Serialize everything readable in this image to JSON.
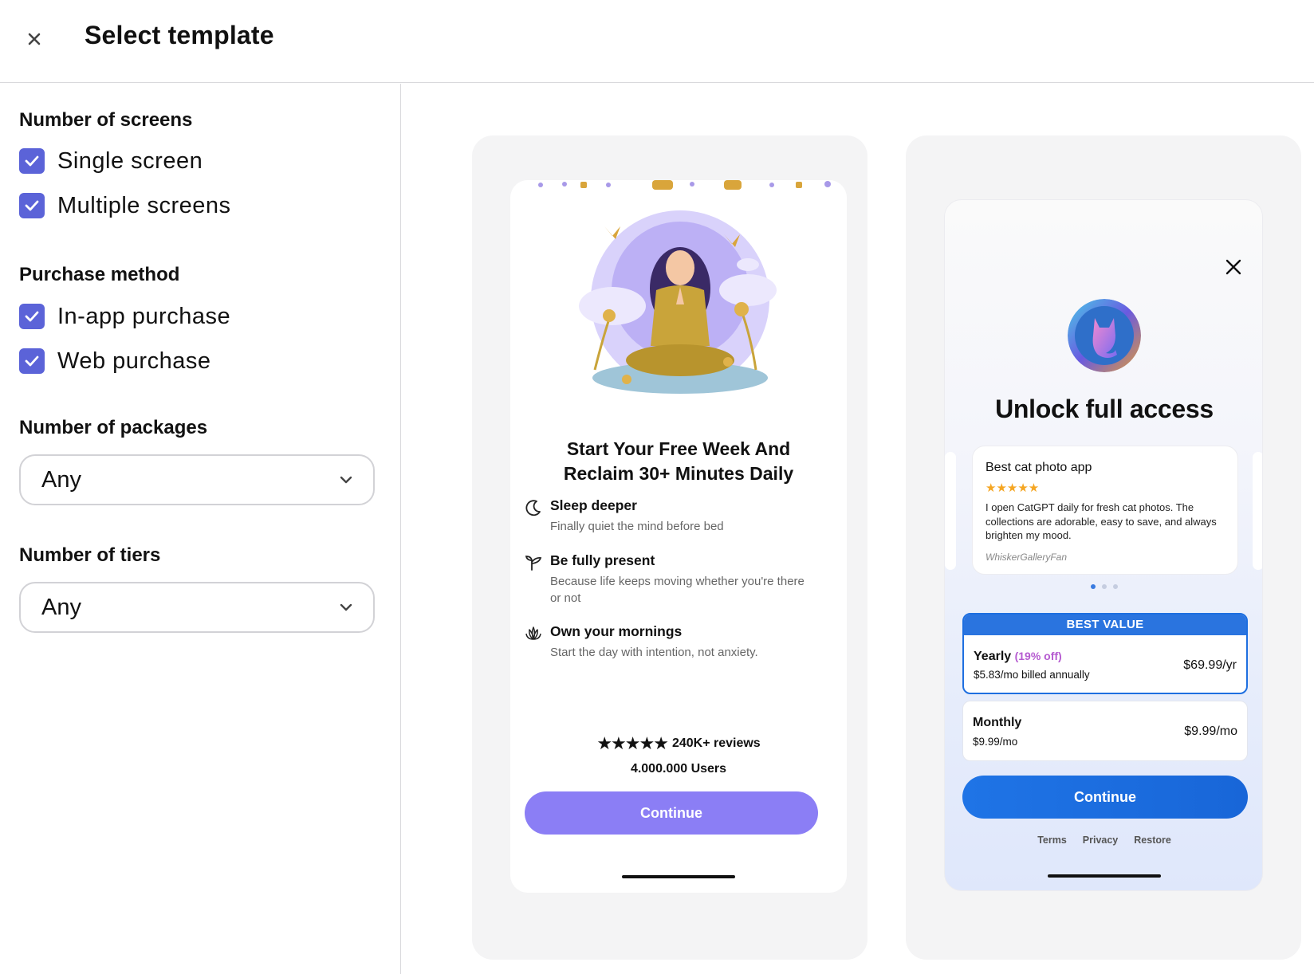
{
  "header": {
    "title": "Select template"
  },
  "sidebar": {
    "screens": {
      "title": "Number of screens",
      "options": [
        "Single screen",
        "Multiple screens"
      ],
      "checked": [
        true,
        true
      ]
    },
    "purchase": {
      "title": "Purchase method",
      "options": [
        "In-app purchase",
        "Web purchase"
      ],
      "checked": [
        true,
        true
      ]
    },
    "packages": {
      "title": "Number of packages",
      "value": "Any"
    },
    "tiers": {
      "title": "Number of tiers",
      "value": "Any"
    }
  },
  "templates": [
    {
      "headline_line1": "Start Your Free Week And",
      "headline_line2": "Reclaim 30+ Minutes Daily",
      "features": [
        {
          "icon": "moon-icon",
          "title": "Sleep deeper",
          "desc": "Finally quiet the mind before bed"
        },
        {
          "icon": "sprout-icon",
          "title": "Be fully present",
          "desc": "Because life keeps moving whether you're there or not"
        },
        {
          "icon": "lotus-icon",
          "title": "Own your mornings",
          "desc": "Start the day with intention, not anxiety."
        }
      ],
      "stars": "★★★★★",
      "reviews": "240K+ reviews",
      "users": "4.000.000 Users",
      "cta": "Continue",
      "accent": "#8b7ef5"
    },
    {
      "headline": "Unlock full access",
      "review": {
        "title": "Best cat photo app",
        "stars": "★★★★★",
        "body": "I open CatGPT daily for fresh cat photos. The collections are adorable, easy to save, and always brighten my mood.",
        "author": "WhiskerGalleryFan"
      },
      "badge": "BEST VALUE",
      "packages": [
        {
          "name": "Yearly",
          "discount": "(19% off)",
          "sub": "$5.83/mo billed annually",
          "price": "$69.99/yr"
        },
        {
          "name": "Monthly",
          "sub": "$9.99/mo",
          "price": "$9.99/mo"
        }
      ],
      "cta": "Continue",
      "links": [
        "Terms",
        "Privacy",
        "Restore"
      ],
      "accent": "#1f74e6"
    }
  ]
}
